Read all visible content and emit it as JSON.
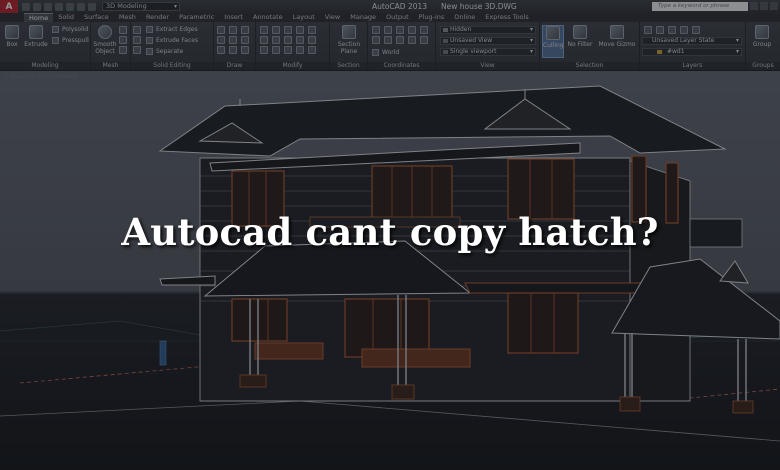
{
  "app": {
    "logo": "A",
    "title": "AutoCAD 2013",
    "file": "New house 3D.DWG",
    "workspace": "3D Modeling",
    "search_placeholder": "Type a keyword or phrase"
  },
  "tabs": [
    "Home",
    "Solid",
    "Surface",
    "Mesh",
    "Render",
    "Parametric",
    "Insert",
    "Annotate",
    "Layout",
    "View",
    "Manage",
    "Output",
    "Plug-ins",
    "Online",
    "Express Tools"
  ],
  "active_tab": "Home",
  "ribbon": {
    "modeling": {
      "title": "Modeling",
      "box": "Box",
      "extrude": "Extrude",
      "polysolid": "Polysolid",
      "presspull": "Presspull"
    },
    "mesh": {
      "title": "Mesh",
      "smooth": "Smooth Object"
    },
    "solid_editing": {
      "title": "Solid Editing",
      "extract_edges": "Extract Edges",
      "extrude_faces": "Extrude Faces",
      "separate": "Separate"
    },
    "draw": {
      "title": "Draw"
    },
    "modify": {
      "title": "Modify"
    },
    "section": {
      "title": "Section",
      "plane": "Section Plane"
    },
    "coordinates": {
      "title": "Coordinates",
      "world": "World"
    },
    "view": {
      "title": "View",
      "visual_style": "Hidden",
      "saved_view": "Unsaved View",
      "viewport": "Single viewport"
    },
    "selection": {
      "title": "Selection",
      "culling": "Culling",
      "no_filter": "No Filter",
      "move_gizmo": "Move Gizmo"
    },
    "layers": {
      "title": "Layers",
      "layer_state": "Unsaved Layer State",
      "current_layer": "#wd1"
    },
    "groups": {
      "title": "Groups",
      "group": "Group"
    }
  },
  "headline": "Autocad cant copy hatch?",
  "colors": {
    "layer_swatch": "#c8a23a",
    "wire": "#c9cdd2",
    "accent_wood": "#b05a32",
    "ground_line": "#d36b4a"
  }
}
